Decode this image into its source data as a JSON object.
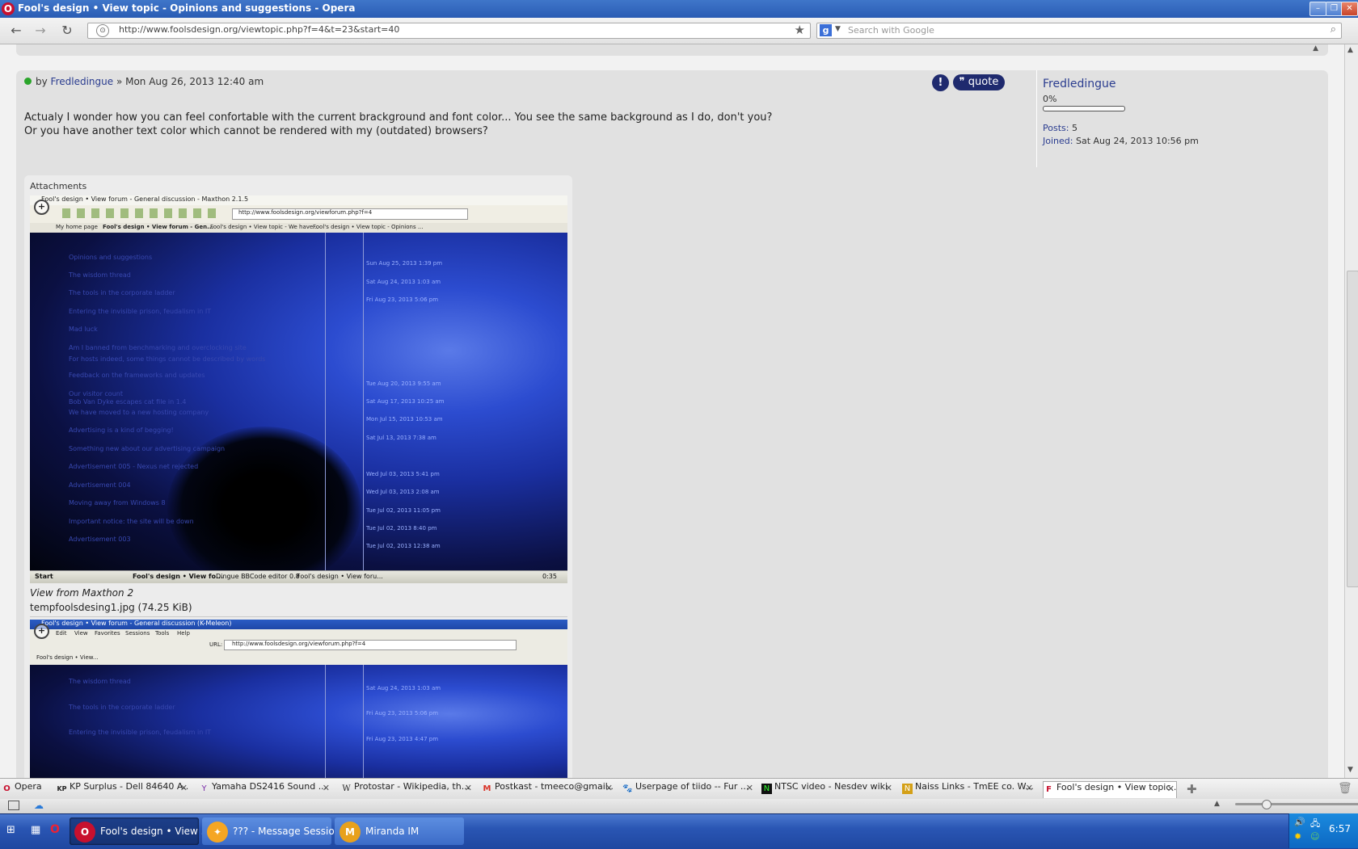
{
  "window": {
    "title": "Fool's design • View topic - Opinions and suggestions - Opera",
    "controls": [
      "–",
      "❐",
      "✕"
    ]
  },
  "addressbar": {
    "url": "http://www.foolsdesign.org/viewtopic.php?f=4&t=23&start=40",
    "search_placeholder": "Search with Google",
    "search_engine": "g"
  },
  "post": {
    "by": "by",
    "author": "Fredledingue",
    "date": "» Mon Aug 26, 2013 12:40 am",
    "report_label": "!",
    "quote_label": "quote",
    "text_line1": "Actualy I wonder how you can feel confortable with the current brackground and font color... You see the same background as I do, don't you?",
    "text_line2": "Or you have another text color which cannot be rendered with my (outdated) browsers?"
  },
  "profile": {
    "username": "Fredledingue",
    "rank": "0%",
    "posts_label": "Posts:",
    "posts_value": "5",
    "joined_label": "Joined:",
    "joined_value": "Sat Aug 24, 2013 10:56 pm"
  },
  "attachments": {
    "heading": "Attachments",
    "items": [
      {
        "window_title": "Fool's design • View forum - General discussion - Maxthon 2.1.5",
        "url": "http://www.foolsdesign.org/viewforum.php?f=4",
        "tabs": [
          "My home page",
          "Fool's design • View forum - Gen...",
          "Fool's design • View topic - We have...",
          "Fool's design • View topic - Opinions ..."
        ],
        "rows": [
          "Opinions and suggestions",
          "The wisdom thread",
          "The tools in the corporate ladder",
          "Entering the invisible prison, feudalism in IT",
          "Mad luck",
          "Am I banned from benchmarking and overclocking site",
          "For hosts indeed, some things cannot be described by words",
          "Feedback on the frameworks and updates",
          "Our visitor count",
          "Bob Van Dyke escapes cat file in 1.4",
          "We have moved to a new hosting company",
          "Advertising is a kind of begging!",
          "Something new about our advertising campaign",
          "Advertisement 005 - Nexus net rejected",
          "Advertisement 004",
          "Moving away from Windows 8",
          "Important notice: the site will be down",
          "Advertisement 003"
        ],
        "dates": [
          "Sun Aug 25, 2013 1:39 pm",
          "Sat Aug 24, 2013 1:03 am",
          "Fri Aug 23, 2013 5:06 pm",
          "Tue Aug 20, 2013 9:55 am",
          "Sat Aug 17, 2013 10:25 am",
          "Mon Jul 15, 2013 10:53 am",
          "Sat Jul 13, 2013 7:38 am",
          "Wed Jul 03, 2013 5:41 pm",
          "Wed Jul 03, 2013 2:08 am",
          "Tue Jul 02, 2013 11:05 pm",
          "Tue Jul 02, 2013 8:40 pm",
          "Tue Jul 02, 2013 12:38 am"
        ],
        "taskbar": [
          "Start",
          "Fool's design • View fo...",
          "Dingue BBCode editor 0.8",
          "Fool's design • View foru..."
        ],
        "clock": "0:35",
        "caption": "View from Maxthon 2",
        "filename": "tempfoolsdesing1.jpg (74.25 KiB)"
      },
      {
        "window_title": "Fool's design • View forum - General discussion (K-Meleon)",
        "url": "http://www.foolsdesign.org/viewforum.php?f=4",
        "url_label": "URL:",
        "menu": [
          "Edit",
          "View",
          "Favorites",
          "Sessions",
          "Tools",
          "Help"
        ],
        "tab": "Fool's design • View...",
        "rows": [
          "The wisdom thread",
          "The tools in the corporate ladder",
          "Entering the invisible prison, feudalism in IT"
        ],
        "dates": [
          "Sat Aug 24, 2013 1:03 am",
          "Fri Aug 23, 2013 5:06 pm",
          "Fri Aug 23, 2013 4:47 pm"
        ]
      }
    ]
  },
  "tabs": [
    {
      "icon": "opera-icon",
      "label": "Opera",
      "glyph": "O",
      "color": "#c8102e"
    },
    {
      "icon": "kp-icon",
      "label": "KP Surplus - Dell 84640 A...",
      "glyph": "KP",
      "color": "#333333"
    },
    {
      "icon": "yamaha-icon",
      "label": "Yamaha DS2416 Sound ...",
      "glyph": "Y",
      "color": "#7a2aa8"
    },
    {
      "icon": "wikipedia-icon",
      "label": "Protostar - Wikipedia, th...",
      "glyph": "W",
      "color": "#111111"
    },
    {
      "icon": "gmail-icon",
      "label": "Postkast - tmeeco@gmail...",
      "glyph": "M",
      "color": "#d93025"
    },
    {
      "icon": "paw-icon",
      "label": "Userpage of tiido -- Fur ...",
      "glyph": "🐾",
      "color": "#222222"
    },
    {
      "icon": "nesdev-icon",
      "label": "NTSC video - Nesdev wiki",
      "glyph": "N",
      "color": "#1b7a1b"
    },
    {
      "icon": "badge-icon",
      "label": "Naiss Links - TmEE co. W...",
      "glyph": "N",
      "color": "#d4a017"
    },
    {
      "icon": "fools-icon",
      "label": "Fool's design • View topic...",
      "glyph": "F",
      "color": "#c8102e",
      "active": true
    }
  ],
  "taskbar": {
    "items": [
      {
        "label": "Fool's design • View ...",
        "glyph": "O",
        "active": true
      },
      {
        "label": "??? - Message Session",
        "glyph": "✦",
        "active": false
      },
      {
        "label": "Miranda IM",
        "glyph": "M",
        "active": false
      }
    ],
    "clock": "6:57"
  },
  "colors": {
    "accent": "#1f2a6e",
    "link": "#2a3c8f",
    "opera_red": "#c8102e"
  }
}
